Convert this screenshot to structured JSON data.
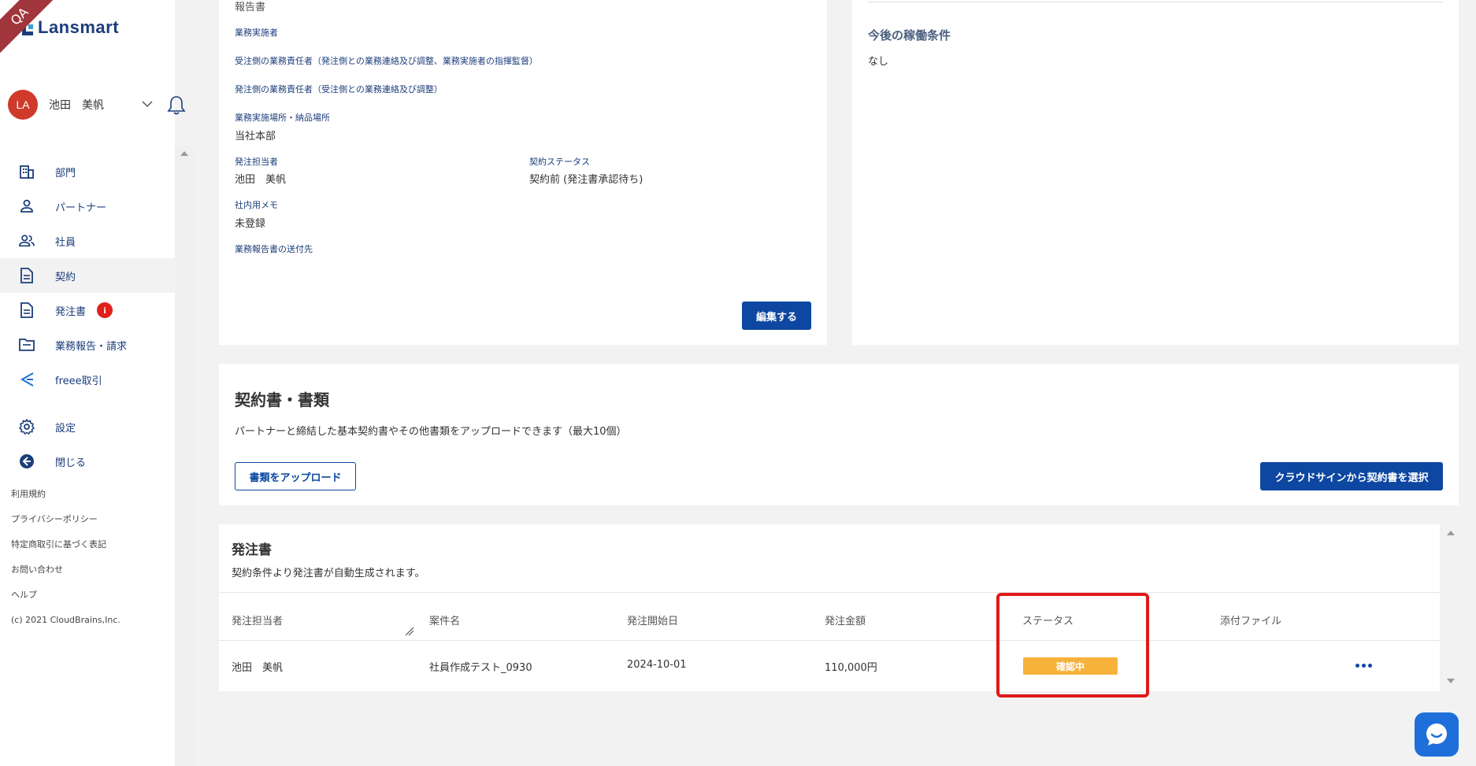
{
  "qa_ribbon": "QA",
  "app": {
    "logo_text": "Lansmart"
  },
  "user": {
    "initials": "LA",
    "name": "池田　美帆"
  },
  "nav": {
    "items": [
      {
        "label": "部門",
        "icon": "building-icon"
      },
      {
        "label": "パートナー",
        "icon": "person-icon"
      },
      {
        "label": "社員",
        "icon": "people-icon"
      },
      {
        "label": "契約",
        "icon": "document-icon",
        "active": true
      },
      {
        "label": "発注書",
        "icon": "document-icon",
        "badge": "i"
      },
      {
        "label": "業務報告・請求",
        "icon": "folder-icon"
      },
      {
        "label": "freee取引",
        "icon": "freee-icon"
      },
      {
        "label": "設定",
        "icon": "gear-icon"
      },
      {
        "label": "閉じる",
        "icon": "back-arrow-icon"
      }
    ]
  },
  "footer_links": [
    "利用規約",
    "プライバシーポリシー",
    "特定商取引に基づく表記",
    "お問い合わせ",
    "ヘルプ",
    "(c) 2021 CloudBrains,Inc."
  ],
  "contract_detail": {
    "top_label": "報告書",
    "fields": [
      {
        "label": "業務実施者",
        "value": ""
      },
      {
        "label": "受注側の業務責任者（発注側との業務連絡及び調整、業務実施者の指揮監督）",
        "value": ""
      },
      {
        "label": "発注側の業務責任者（受注側との業務連絡及び調整）",
        "value": ""
      },
      {
        "label": "業務実施場所・納品場所",
        "value": "当社本部"
      }
    ],
    "owner_label": "発注担当者",
    "owner_value": "池田　美帆",
    "status_label": "契約ステータス",
    "status_value": "契約前 (発注書承認待ち)",
    "memo_label": "社内用メモ",
    "memo_value": "未登録",
    "report_dest_label": "業務報告書の送付先",
    "edit_button": "編集する"
  },
  "future_conditions": {
    "title": "今後の稼働条件",
    "value": "なし"
  },
  "documents": {
    "title": "契約書・書類",
    "description": "パートナーと締結した基本契約書やその他書類をアップロードできます（最大10個）",
    "upload_button": "書類をアップロード",
    "cloudsign_button": "クラウドサインから契約書を選択"
  },
  "purchase_orders": {
    "title": "発注書",
    "description": "契約条件より発注書が自動生成されます。",
    "columns": [
      "発注担当者",
      "案件名",
      "発注開始日",
      "発注金額",
      "ステータス",
      "添付ファイル"
    ],
    "rows": [
      {
        "owner": "池田　美帆",
        "project": "社員作成テスト_0930",
        "start_date": "2024-10-01",
        "amount": "110,000円",
        "status": "確認中"
      }
    ]
  },
  "colors": {
    "brand": "#1b3d7a",
    "primary_button": "#0d47a1",
    "status_pending": "#f7b23b",
    "highlight": "#e0191a",
    "avatar": "#cf3a2b"
  }
}
